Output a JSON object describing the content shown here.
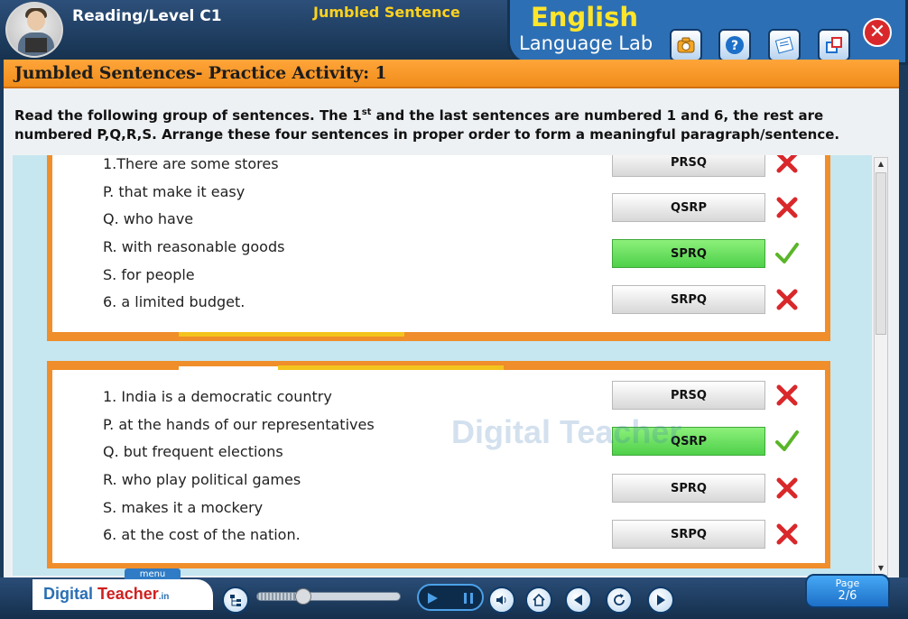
{
  "header": {
    "level_title": "Reading/Level C1",
    "activity_name": "Jumbled Sentence",
    "lab_title_main": "English",
    "lab_title_sub": "Language Lab",
    "tool_icons": [
      "camera-icon",
      "help-icon",
      "notes-icon",
      "window-icon"
    ],
    "close_icon": "close-icon"
  },
  "activity": {
    "title": "Jumbled Sentences- Practice Activity: 1",
    "instructions_part1": "Read the following group of sentences. The 1",
    "instructions_sup": "st",
    "instructions_part2": " and the last sentences are numbered 1 and 6, the rest are numbered P,Q,R,S. Arrange these four sentences in proper order to form a meaningful paragraph/sentence."
  },
  "questions": [
    {
      "sentences": [
        "1.There are some stores",
        "P. that make it easy",
        "Q. who have",
        "R. with reasonable goods",
        "S. for people",
        "6. a limited budget."
      ],
      "options": [
        {
          "label": "PRSQ",
          "result": "wrong"
        },
        {
          "label": "QSRP",
          "result": "wrong"
        },
        {
          "label": "SPRQ",
          "result": "correct"
        },
        {
          "label": "SRPQ",
          "result": "wrong"
        }
      ]
    },
    {
      "sentences": [
        "1. India is a democratic country",
        "P. at the hands of our representatives",
        "Q. but frequent elections",
        "R. who play political games",
        "S. makes it a mockery",
        "6. at the cost of the nation."
      ],
      "options": [
        {
          "label": "PRSQ",
          "result": "wrong"
        },
        {
          "label": "QSRP",
          "result": "correct"
        },
        {
          "label": "SPRQ",
          "result": "wrong"
        },
        {
          "label": "SRPQ",
          "result": "wrong"
        }
      ]
    }
  ],
  "watermark": {
    "text": "Digital Teacher",
    "suffix": ".in"
  },
  "footer": {
    "menu_label": "menu",
    "logo_main": "Digital",
    "logo_accent": "Teacher",
    "logo_suffix": ".in",
    "page_label": "Page",
    "page_number": "2/6",
    "progress_fraction": 0.32
  },
  "colors": {
    "accent_orange": "#ef8e2a",
    "correct_green": "#4fd04a",
    "wrong_red": "#d9282b",
    "brand_blue": "#2d6fb4"
  }
}
